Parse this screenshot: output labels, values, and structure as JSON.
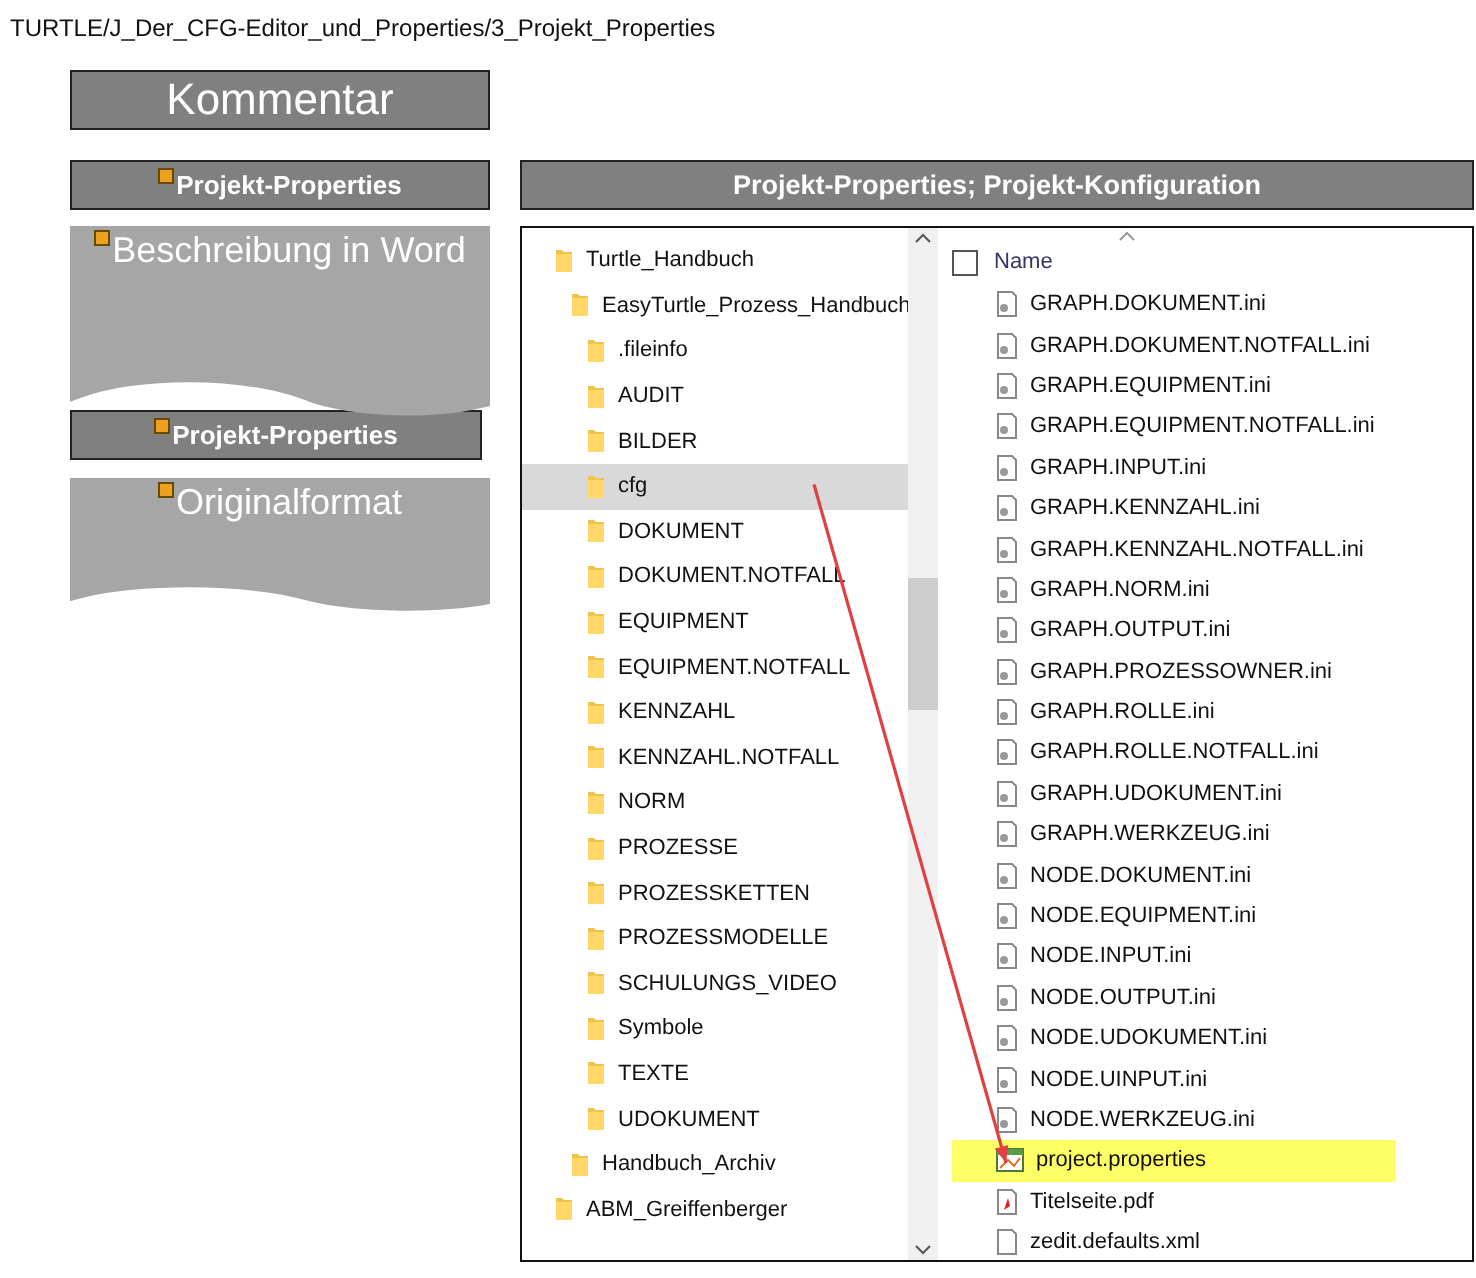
{
  "breadcrumb": "TURTLE/J_Der_CFG-Editor_und_Properties/3_Projekt_Properties",
  "comment_button": {
    "label": "Kommentar"
  },
  "left_column": [
    {
      "kind": "heading",
      "label": "Projekt-Properties"
    },
    {
      "kind": "document",
      "label": "Beschreibung in Word"
    },
    {
      "kind": "heading",
      "label": "Projekt-Properties"
    },
    {
      "kind": "document",
      "label": "Originalformat"
    }
  ],
  "explorer": {
    "heading": "Projekt-Properties; Projekt-Konfiguration",
    "tree": [
      {
        "label": "Turtle_Handbuch",
        "selected": false,
        "children": [
          {
            "label": "EasyTurtle_Prozess_Handbuch",
            "selected": false,
            "children": [
              {
                "label": ".fileinfo",
                "selected": false
              },
              {
                "label": "AUDIT",
                "selected": false
              },
              {
                "label": "BILDER",
                "selected": false
              },
              {
                "label": "cfg",
                "selected": true
              },
              {
                "label": "DOKUMENT",
                "selected": false
              },
              {
                "label": "DOKUMENT.NOTFALL",
                "selected": false
              },
              {
                "label": "EQUIPMENT",
                "selected": false
              },
              {
                "label": "EQUIPMENT.NOTFALL",
                "selected": false
              },
              {
                "label": "KENNZAHL",
                "selected": false
              },
              {
                "label": "KENNZAHL.NOTFALL",
                "selected": false
              },
              {
                "label": "NORM",
                "selected": false
              },
              {
                "label": "PROZESSE",
                "selected": false
              },
              {
                "label": "PROZESSKETTEN",
                "selected": false
              },
              {
                "label": "PROZESSMODELLE",
                "selected": false
              },
              {
                "label": "SCHULUNGS_VIDEO",
                "selected": false
              },
              {
                "label": "Symbole",
                "selected": false
              },
              {
                "label": "TEXTE",
                "selected": false
              },
              {
                "label": "UDOKUMENT",
                "selected": false
              }
            ]
          },
          {
            "label": "Handbuch_Archiv",
            "selected": false
          }
        ]
      },
      {
        "label": "ABM_Greiffenberger",
        "selected": false
      }
    ],
    "files_header": {
      "label": "Name",
      "checked": false
    },
    "files": [
      {
        "name": "GRAPH.DOKUMENT.ini",
        "kind": "ini",
        "highlighted": false
      },
      {
        "name": "GRAPH.DOKUMENT.NOTFALL.ini",
        "kind": "ini",
        "highlighted": false
      },
      {
        "name": "GRAPH.EQUIPMENT.ini",
        "kind": "ini",
        "highlighted": false
      },
      {
        "name": "GRAPH.EQUIPMENT.NOTFALL.ini",
        "kind": "ini",
        "highlighted": false
      },
      {
        "name": "GRAPH.INPUT.ini",
        "kind": "ini",
        "highlighted": false
      },
      {
        "name": "GRAPH.KENNZAHL.ini",
        "kind": "ini",
        "highlighted": false
      },
      {
        "name": "GRAPH.KENNZAHL.NOTFALL.ini",
        "kind": "ini",
        "highlighted": false
      },
      {
        "name": "GRAPH.NORM.ini",
        "kind": "ini",
        "highlighted": false
      },
      {
        "name": "GRAPH.OUTPUT.ini",
        "kind": "ini",
        "highlighted": false
      },
      {
        "name": "GRAPH.PROZESSOWNER.ini",
        "kind": "ini",
        "highlighted": false
      },
      {
        "name": "GRAPH.ROLLE.ini",
        "kind": "ini",
        "highlighted": false
      },
      {
        "name": "GRAPH.ROLLE.NOTFALL.ini",
        "kind": "ini",
        "highlighted": false
      },
      {
        "name": "GRAPH.UDOKUMENT.ini",
        "kind": "ini",
        "highlighted": false
      },
      {
        "name": "GRAPH.WERKZEUG.ini",
        "kind": "ini",
        "highlighted": false
      },
      {
        "name": "NODE.DOKUMENT.ini",
        "kind": "ini",
        "highlighted": false
      },
      {
        "name": "NODE.EQUIPMENT.ini",
        "kind": "ini",
        "highlighted": false
      },
      {
        "name": "NODE.INPUT.ini",
        "kind": "ini",
        "highlighted": false
      },
      {
        "name": "NODE.OUTPUT.ini",
        "kind": "ini",
        "highlighted": false
      },
      {
        "name": "NODE.UDOKUMENT.ini",
        "kind": "ini",
        "highlighted": false
      },
      {
        "name": "NODE.UINPUT.ini",
        "kind": "ini",
        "highlighted": false
      },
      {
        "name": "NODE.WERKZEUG.ini",
        "kind": "ini",
        "highlighted": false
      },
      {
        "name": "project.properties",
        "kind": "properties",
        "highlighted": true
      },
      {
        "name": "Titelseite.pdf",
        "kind": "pdf",
        "highlighted": false
      },
      {
        "name": "zedit.defaults.xml",
        "kind": "file",
        "highlighted": false
      }
    ]
  }
}
